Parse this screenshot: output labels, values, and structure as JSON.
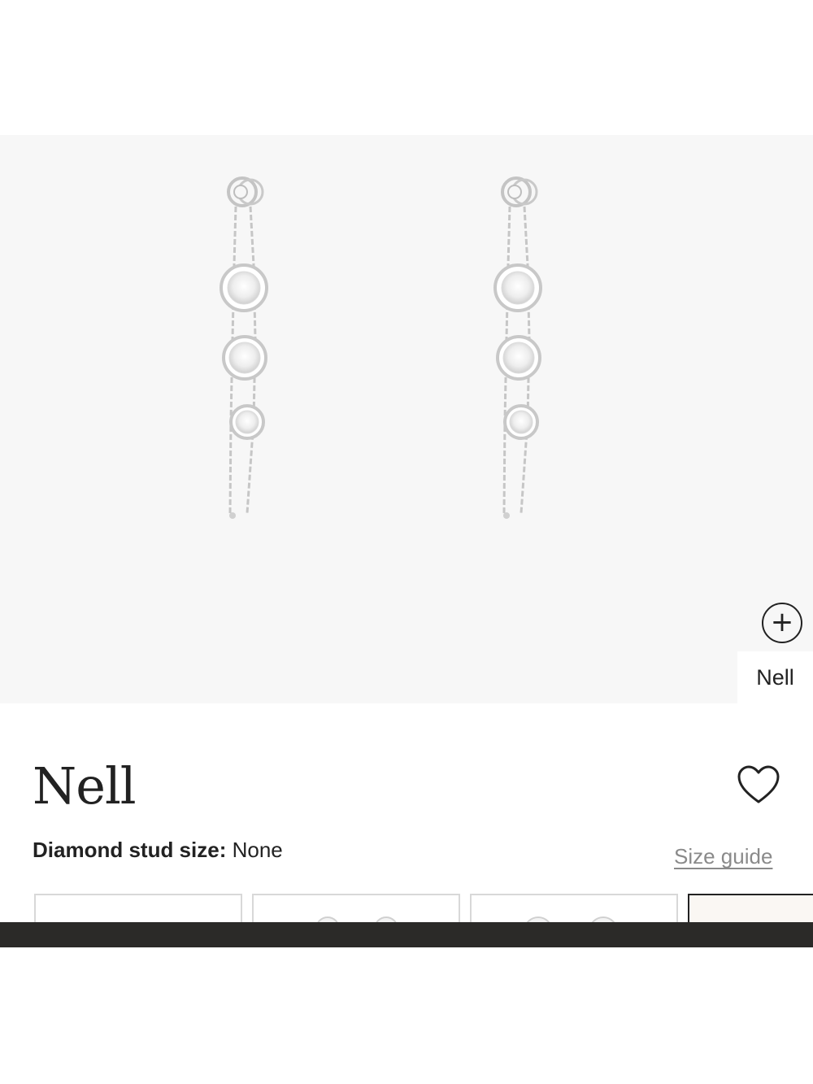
{
  "product": {
    "name": "Nell",
    "image_variant_label": "Nell",
    "option": {
      "label": "Diamond stud size:",
      "value": "None"
    },
    "size_guide_label": "Size guide",
    "swatches": [
      {
        "name": "none",
        "selected": false
      },
      {
        "name": "small",
        "selected": false
      },
      {
        "name": "medium",
        "selected": false
      },
      {
        "name": "large",
        "selected": true
      }
    ]
  },
  "icons": {
    "zoom": "plus-circle-icon",
    "wishlist": "heart-outline-icon"
  },
  "colors": {
    "hero_background": "#f7f7f7",
    "text": "#222222",
    "link_muted": "#8a8a8a",
    "bottom_bar": "#2b2a28",
    "metal": "#c8c8c8"
  }
}
